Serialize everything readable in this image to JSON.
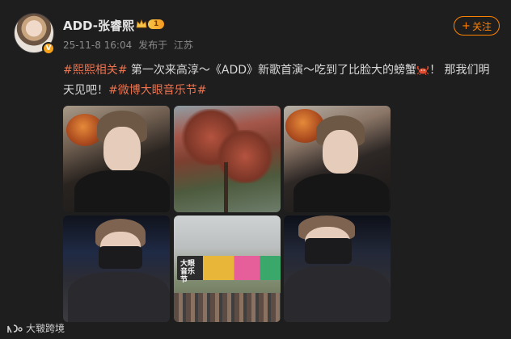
{
  "post": {
    "author": {
      "name": "ADD-张睿熙",
      "level": "1",
      "verified_badge": "V"
    },
    "meta": {
      "timestamp": "25-11-8 16:04",
      "location_prefix": "发布于",
      "location": "江苏"
    },
    "follow_label": "关注",
    "text": {
      "tag1": "#熙熙相关#",
      "body1": " 第一次来高淳～《ADD》新歌首演～吃到了比脸大的螃蟹",
      "body2": "！ 那我们明天见吧！",
      "tag2": "#微博大眼音乐节#"
    },
    "photos": [
      {
        "subject": "selfie-with-crab"
      },
      {
        "subject": "autumn-tree"
      },
      {
        "subject": "selfie-with-crab"
      },
      {
        "subject": "masked-selfie"
      },
      {
        "subject": "festival-banner",
        "banner_text": "大眼音乐节"
      },
      {
        "subject": "masked-selfie"
      }
    ]
  },
  "watermark": {
    "text": "大皲跨境"
  },
  "colors": {
    "background": "#1e1e1e",
    "accent": "#ff8200",
    "hashtag": "#eb7350",
    "level": "#f39a1f"
  },
  "icons": [
    "crown-icon",
    "verified-badge-icon",
    "plus-icon",
    "crab-emoji-icon",
    "watermark-logo-icon"
  ]
}
